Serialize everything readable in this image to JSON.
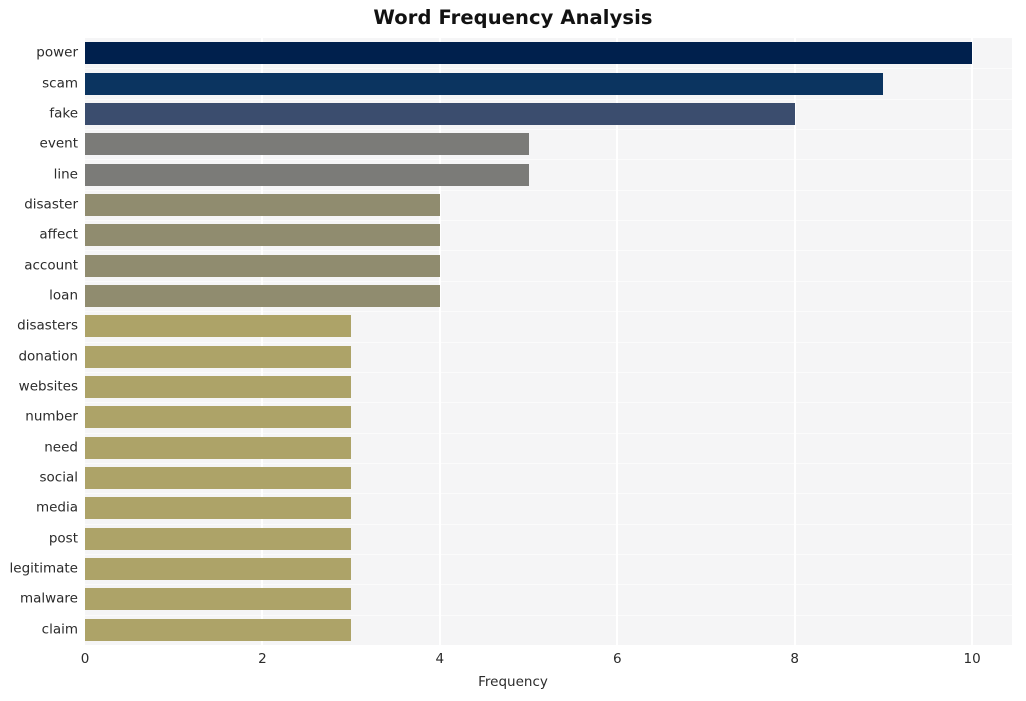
{
  "chart_data": {
    "type": "bar",
    "orientation": "horizontal",
    "title": "Word Frequency Analysis",
    "xlabel": "Frequency",
    "ylabel": "",
    "xlim": [
      0,
      10.45
    ],
    "xticks": [
      0,
      2,
      4,
      6,
      8,
      10
    ],
    "xtick_labels": [
      "0",
      "2",
      "4",
      "6",
      "8",
      "10"
    ],
    "grid": "vertical-white-on-light-gray",
    "legend": "none",
    "categories": [
      "power",
      "scam",
      "fake",
      "event",
      "line",
      "disaster",
      "affect",
      "account",
      "loan",
      "disasters",
      "donation",
      "websites",
      "number",
      "need",
      "social",
      "media",
      "post",
      "legitimate",
      "malware",
      "claim"
    ],
    "values": [
      10,
      9,
      8,
      5,
      5,
      4,
      4,
      4,
      4,
      3,
      3,
      3,
      3,
      3,
      3,
      3,
      3,
      3,
      3,
      3
    ],
    "bar_colors": [
      "#00204d",
      "#0b3460",
      "#3b4d6e",
      "#7b7b78",
      "#7b7b78",
      "#908c6f",
      "#908c6f",
      "#908c6f",
      "#908c6f",
      "#ada368",
      "#ada368",
      "#ada368",
      "#ada368",
      "#ada368",
      "#ada368",
      "#ada368",
      "#ada368",
      "#ada368",
      "#ada368",
      "#ada368"
    ],
    "plot_background": "#f5f5f6",
    "figure_background": "#ffffff",
    "gridline_color": "#ffffff",
    "text_color": "#2b2b2b",
    "title_color": "#121212"
  }
}
